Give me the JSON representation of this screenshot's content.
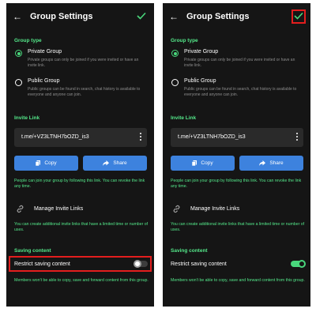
{
  "colors": {
    "accent_green": "#49d77c",
    "button_blue": "#3d82de",
    "highlight_red": "#e31e1e",
    "background": "#151515"
  },
  "screens": [
    {
      "id": "before",
      "title": "Group Settings",
      "group_type_label": "Group type",
      "private_title": "Private Group",
      "private_desc": "Private groups can only be joined if you were invited or have an invite link.",
      "public_title": "Public Group",
      "public_desc": "Public groups can be found in search, chat history is available to everyone and anyone can join.",
      "selected_type": "Private Group",
      "invite_link_label": "Invite Link",
      "invite_link_value": "t.me/+VZ3LTNH7bOZD_is3",
      "copy_label": "Copy",
      "share_label": "Share",
      "join_note": "People can join your group by following this link. You can revoke the link any time.",
      "manage_label": "Manage Invite Links",
      "manage_note": "You can create additional invite links that have a limited time or number of uses.",
      "saving_content_label": "Saving content",
      "restrict_label": "Restrict saving content",
      "restrict_enabled": false,
      "members_note": "Members won't be able to copy, save and forward content from this group."
    },
    {
      "id": "after",
      "title": "Group Settings",
      "group_type_label": "Group type",
      "private_title": "Private Group",
      "private_desc": "Private groups can only be joined if you were invited or have an invite link.",
      "public_title": "Public Group",
      "public_desc": "Public groups can be found in search, chat history is available to everyone and anyone can join.",
      "selected_type": "Private Group",
      "invite_link_label": "Invite Link",
      "invite_link_value": "t.me/+VZ3LTNH7bOZD_is3",
      "copy_label": "Copy",
      "share_label": "Share",
      "join_note": "People can join your group by following this link. You can revoke the link any time.",
      "manage_label": "Manage Invite Links",
      "manage_note": "You can create additional invite links that have a limited time or number of uses.",
      "saving_content_label": "Saving content",
      "restrict_label": "Restrict saving content",
      "restrict_enabled": true,
      "members_note": "Members won't be able to copy, save and forward content from this group."
    }
  ],
  "highlights": {
    "before": "restrict-saving-content-row",
    "after": "save-checkmark-button"
  }
}
